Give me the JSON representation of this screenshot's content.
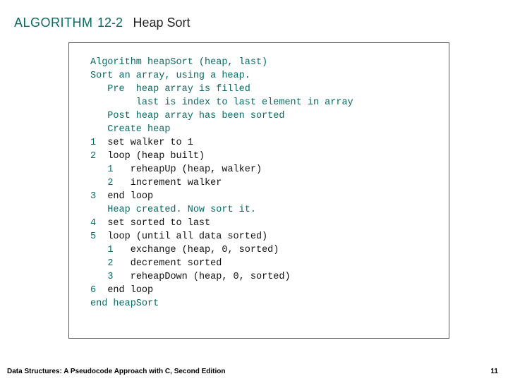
{
  "header": {
    "label": "ALGORITHM",
    "number": "12-2",
    "title": "Heap Sort"
  },
  "code": {
    "sig": "Algorithm heapSort (heap, last)",
    "desc": "Sort an array, using a heap.",
    "pre1": "   Pre  heap array is filled",
    "pre2": "        last is index to last element in array",
    "post": "   Post heap array has been sorted",
    "comment1": "   Create heap",
    "l1": "set walker to 1",
    "l2": "loop (heap built)",
    "l2a": "reheapUp (heap, walker)",
    "l2b": "increment walker",
    "l3": "end loop",
    "comment2": "   Heap created. Now sort it.",
    "l4": "set sorted to last",
    "l5": "loop (until all data sorted)",
    "l5a": "exchange (heap, 0, sorted)",
    "l5b": "decrement sorted",
    "l5c": "reheapDown (heap, 0, sorted)",
    "l6": "end loop",
    "end": "end heapSort",
    "n1": "1",
    "n2": "2",
    "n3": "3",
    "n4": "4",
    "n5": "5",
    "n6": "6",
    "in1": "1",
    "in2": "2",
    "in3": "3"
  },
  "footer": {
    "text": "Data Structures: A Pseudocode Approach with C, Second Edition",
    "page": "11"
  }
}
